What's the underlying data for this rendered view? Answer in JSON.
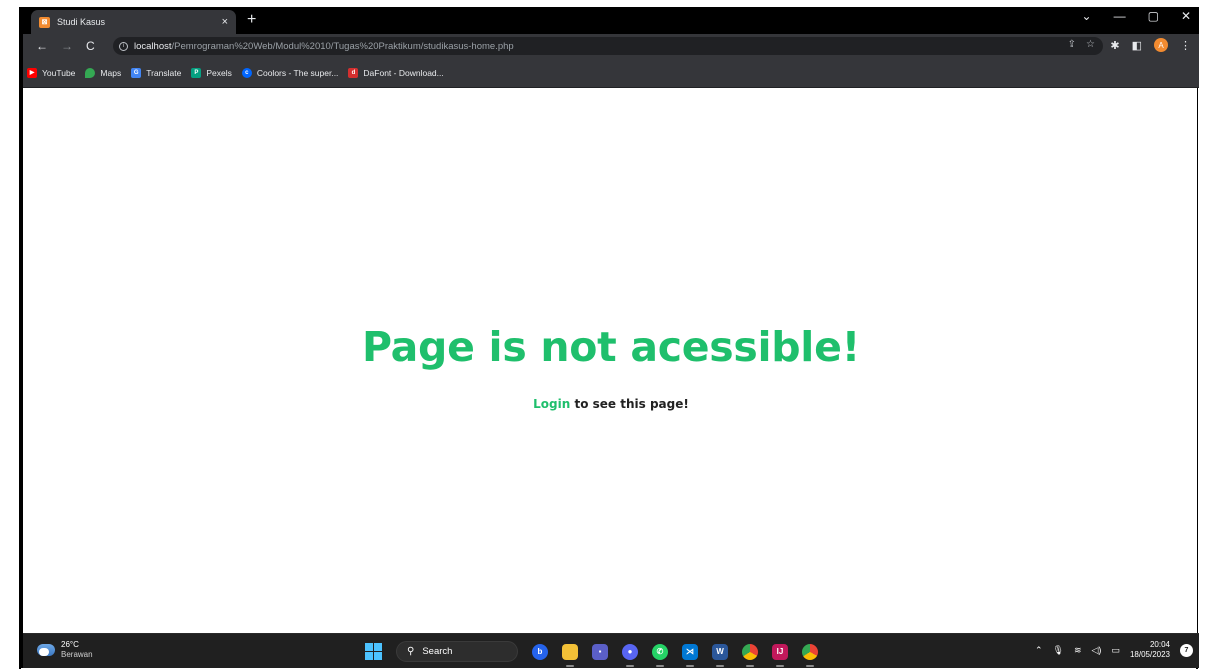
{
  "browser": {
    "tab_title": "Studi Kasus",
    "tab_close": "×",
    "new_tab": "+",
    "url_host": "localhost",
    "url_path": "/Pemrograman%20Web/Modul%2010/Tugas%20Praktikum/studikasus-home.php",
    "profile_initial": "A",
    "window_controls": [
      "⌄",
      "—",
      "▢",
      "✕"
    ]
  },
  "bookmarks": [
    {
      "label": "YouTube",
      "icon": "youtube-icon",
      "color": "#ff0000"
    },
    {
      "label": "Maps",
      "icon": "maps-icon",
      "color": "#34a853"
    },
    {
      "label": "Translate",
      "icon": "translate-icon",
      "color": "#4285f4"
    },
    {
      "label": "Pexels",
      "icon": "pexels-icon",
      "color": "#05a081"
    },
    {
      "label": "Coolors - The super...",
      "icon": "coolors-icon",
      "color": "#0066ff"
    },
    {
      "label": "DaFont - Download...",
      "icon": "dafont-icon",
      "color": "#d32f2f"
    }
  ],
  "page": {
    "headline": "Page is not acessible!",
    "login_link": "Login",
    "subtext": " to see this page!",
    "accent_color": "#1fbf6c"
  },
  "taskbar": {
    "weather_temp": "26°C",
    "weather_desc": "Berawan",
    "search_label": "Search",
    "time": "20:04",
    "date": "18/05/2023",
    "notification_count": "7"
  }
}
